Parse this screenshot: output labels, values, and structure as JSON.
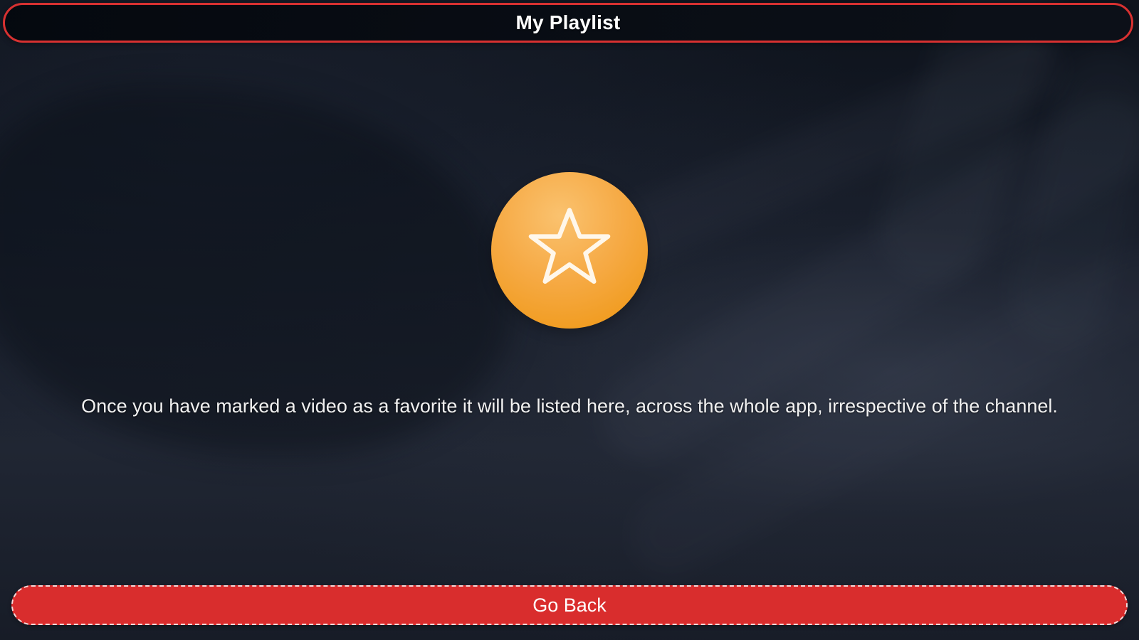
{
  "header": {
    "title": "My Playlist"
  },
  "empty_state": {
    "icon": "star-icon",
    "message": "Once you have marked a video as a favorite it will be listed here, across the whole app, irrespective of the channel."
  },
  "actions": {
    "go_back_label": "Go Back"
  },
  "colors": {
    "header_border": "#d83131",
    "button_background": "#d92d2d",
    "badge_orange": "#f6aa45",
    "text": "#f1f1f1"
  }
}
